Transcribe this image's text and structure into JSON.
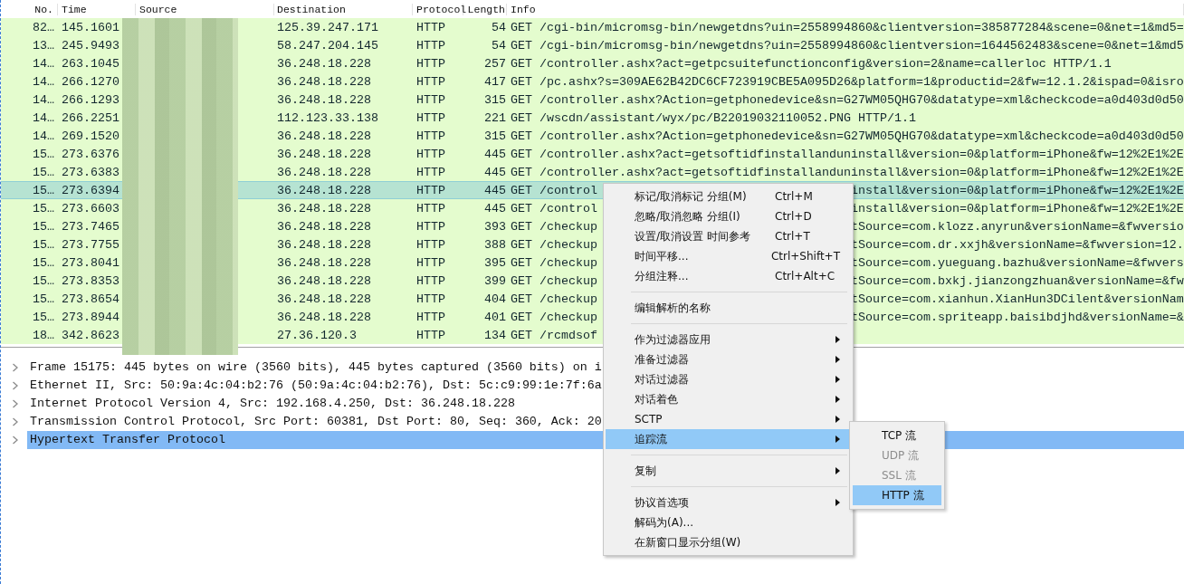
{
  "packet_list": {
    "columns": [
      "No.",
      "Time",
      "Source",
      "Destination",
      "Protocol",
      "Length",
      "Info"
    ],
    "rows": [
      {
        "no": "82…",
        "time": "145.1601",
        "destination": "125.39.247.171",
        "protocol": "HTTP",
        "length": "54",
        "info": "GET /cgi-bin/micromsg-bin/newgetdns?uin=2558994860&clientversion=385877284&scene=0&net=1&md5=",
        "selected": false
      },
      {
        "no": "13…",
        "time": "245.9493",
        "destination": "58.247.204.145",
        "protocol": "HTTP",
        "length": "54",
        "info": "GET /cgi-bin/micromsg-bin/newgetdns?uin=2558994860&clientversion=1644562483&scene=0&net=1&md5",
        "selected": false
      },
      {
        "no": "14…",
        "time": "263.1045",
        "destination": "36.248.18.228",
        "protocol": "HTTP",
        "length": "257",
        "info": "GET /controller.ashx?act=getpcsuitefunctionconfig&version=2&name=callerloc HTTP/1.1",
        "selected": false
      },
      {
        "no": "14…",
        "time": "266.1270",
        "destination": "36.248.18.228",
        "protocol": "HTTP",
        "length": "417",
        "info": "GET /pc.ashx?s=309AE62B42DC6CF723919CBE5A095D26&platform=1&productid=2&fw=12.1.2&ispad=0&isro",
        "selected": false
      },
      {
        "no": "14…",
        "time": "266.1293",
        "destination": "36.248.18.228",
        "protocol": "HTTP",
        "length": "315",
        "info": "GET /controller.ashx?Action=getphonedevice&sn=G27WM05QHG70&datatype=xml&checkcode=a0d403d0d50",
        "selected": false
      },
      {
        "no": "14…",
        "time": "266.2251",
        "destination": "112.123.33.138",
        "protocol": "HTTP",
        "length": "221",
        "info": "GET /wscdn/assistant/wyx/pc/B22019032110052.PNG HTTP/1.1",
        "selected": false
      },
      {
        "no": "14…",
        "time": "269.1520",
        "destination": "36.248.18.228",
        "protocol": "HTTP",
        "length": "315",
        "info": "GET /controller.ashx?Action=getphonedevice&sn=G27WM05QHG70&datatype=xml&checkcode=a0d403d0d50",
        "selected": false
      },
      {
        "no": "15…",
        "time": "273.6376",
        "destination": "36.248.18.228",
        "protocol": "HTTP",
        "length": "445",
        "info": "GET /controller.ashx?act=getsoftidfinstallanduninstall&version=0&platform=iPhone&fw=12%2E1%2E",
        "selected": false
      },
      {
        "no": "15…",
        "time": "273.6383",
        "destination": "36.248.18.228",
        "protocol": "HTTP",
        "length": "445",
        "info": "GET /controller.ashx?act=getsoftidfinstallanduninstall&version=0&platform=iPhone&fw=12%2E1%2E",
        "selected": false
      },
      {
        "no": "15…",
        "time": "273.6394",
        "destination": "36.248.18.228",
        "protocol": "HTTP",
        "length": "445",
        "info": "GET /control",
        "info_right": "install&version=0&platform=iPhone&fw=12%2E1%2E",
        "selected": true
      },
      {
        "no": "15…",
        "time": "273.6603",
        "destination": "36.248.18.228",
        "protocol": "HTTP",
        "length": "445",
        "info": "GET /control",
        "info_right": "install&version=0&platform=iPhone&fw=12%2E1%2E",
        "selected": false
      },
      {
        "no": "15…",
        "time": "273.7465",
        "destination": "36.248.18.228",
        "protocol": "HTTP",
        "length": "393",
        "info": "GET /checkup",
        "info_right": "tSource=com.klozz.anyrun&versionName=&fwversio",
        "selected": false
      },
      {
        "no": "15…",
        "time": "273.7755",
        "destination": "36.248.18.228",
        "protocol": "HTTP",
        "length": "388",
        "info": "GET /checkup",
        "info_right": "tSource=com.dr.xxjh&versionName=&fwversion=12.",
        "selected": false
      },
      {
        "no": "15…",
        "time": "273.8041",
        "destination": "36.248.18.228",
        "protocol": "HTTP",
        "length": "395",
        "info": "GET /checkup",
        "info_right": "tSource=com.yueguang.bazhu&versionName=&fwvers",
        "selected": false
      },
      {
        "no": "15…",
        "time": "273.8353",
        "destination": "36.248.18.228",
        "protocol": "HTTP",
        "length": "399",
        "info": "GET /checkup",
        "info_right": "tSource=com.bxkj.jianzongzhuan&versionName=&fw",
        "selected": false
      },
      {
        "no": "15…",
        "time": "273.8654",
        "destination": "36.248.18.228",
        "protocol": "HTTP",
        "length": "404",
        "info": "GET /checkup",
        "info_right": "tSource=com.xianhun.XianHun3DCilent&versionNam",
        "selected": false
      },
      {
        "no": "15…",
        "time": "273.8944",
        "destination": "36.248.18.228",
        "protocol": "HTTP",
        "length": "401",
        "info": "GET /checkup",
        "info_right": "tSource=com.spriteapp.baisibdjhd&versionName=&",
        "selected": false
      },
      {
        "no": "18…",
        "time": "342.8623",
        "destination": "27.36.120.3",
        "protocol": "HTTP",
        "length": "134",
        "info": "GET /rcmdsof",
        "selected": false
      }
    ]
  },
  "details": [
    {
      "text": "Frame 15175: 445 bytes on wire (3560 bits), 445 bytes captured (3560 bits) on i",
      "expanded": false,
      "selected": false
    },
    {
      "text": "Ethernet II, Src: 50:9a:4c:04:b2:76 (50:9a:4c:04:b2:76), Dst: 5c:c9:99:1e:7f:6a",
      "expanded": false,
      "selected": false
    },
    {
      "text": "Internet Protocol Version 4, Src: 192.168.4.250, Dst: 36.248.18.228",
      "expanded": false,
      "selected": false
    },
    {
      "text": "Transmission Control Protocol, Src Port: 60381, Dst Port: 80, Seq: 360, Ack: 20",
      "expanded": false,
      "selected": false
    },
    {
      "text": "Hypertext Transfer Protocol",
      "expanded": false,
      "selected": true
    }
  ],
  "context_menu": [
    {
      "kind": "item",
      "label": "标记/取消标记 分组(M)",
      "shortcut": "Ctrl+M",
      "submenu": false,
      "selected": false
    },
    {
      "kind": "item",
      "label": "忽略/取消忽略 分组(I)",
      "shortcut": "Ctrl+D",
      "submenu": false,
      "selected": false
    },
    {
      "kind": "item",
      "label": "设置/取消设置 时间参考",
      "shortcut": "Ctrl+T",
      "submenu": false,
      "selected": false
    },
    {
      "kind": "item",
      "label": "时间平移...",
      "shortcut": "Ctrl+Shift+T",
      "submenu": false,
      "selected": false
    },
    {
      "kind": "item",
      "label": "分组注释...",
      "shortcut": "Ctrl+Alt+C",
      "submenu": false,
      "selected": false
    },
    {
      "kind": "separator"
    },
    {
      "kind": "item",
      "label": "编辑解析的名称",
      "submenu": false,
      "selected": false
    },
    {
      "kind": "separator"
    },
    {
      "kind": "item",
      "label": "作为过滤器应用",
      "submenu": true,
      "selected": false
    },
    {
      "kind": "item",
      "label": "准备过滤器",
      "submenu": true,
      "selected": false
    },
    {
      "kind": "item",
      "label": "对话过滤器",
      "submenu": true,
      "selected": false
    },
    {
      "kind": "item",
      "label": "对话着色",
      "submenu": true,
      "selected": false
    },
    {
      "kind": "item",
      "label": "SCTP",
      "submenu": true,
      "selected": false
    },
    {
      "kind": "item",
      "label": "追踪流",
      "submenu": true,
      "selected": true
    },
    {
      "kind": "separator"
    },
    {
      "kind": "item",
      "label": "复制",
      "submenu": true,
      "selected": false
    },
    {
      "kind": "separator"
    },
    {
      "kind": "item",
      "label": "协议首选项",
      "submenu": true,
      "selected": false
    },
    {
      "kind": "item",
      "label": "解码为(A)...",
      "submenu": false,
      "selected": false
    },
    {
      "kind": "item",
      "label": "在新窗口显示分组(W)",
      "submenu": false,
      "selected": false
    }
  ],
  "submenu": [
    {
      "label": "TCP 流",
      "disabled": false,
      "selected": false
    },
    {
      "label": "UDP 流",
      "disabled": true,
      "selected": false
    },
    {
      "label": "SSL 流",
      "disabled": true,
      "selected": false
    },
    {
      "label": "HTTP 流",
      "disabled": false,
      "selected": true
    }
  ]
}
